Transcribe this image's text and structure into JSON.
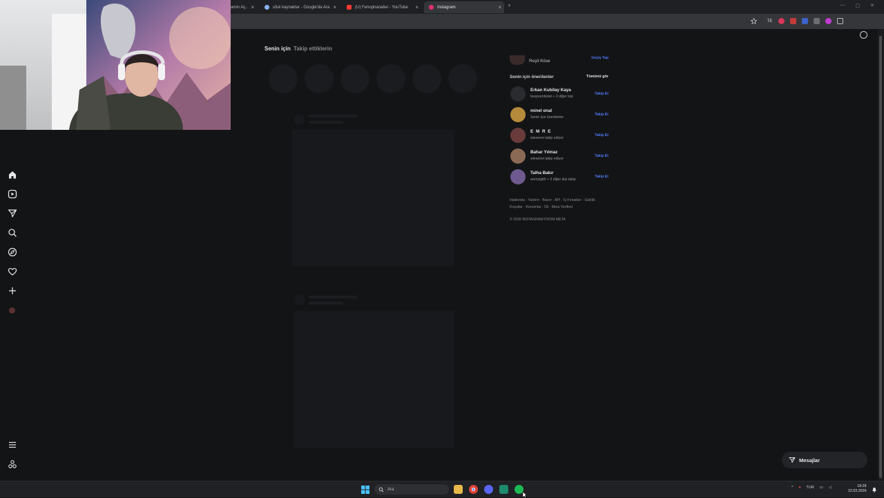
{
  "browser": {
    "tabs": [
      {
        "title": "...amin Aç..",
        "icon_color": "#7d7d7d"
      },
      {
        "title": "ufuk kaynaktar - Google'da Ara",
        "icon_color": "#8ab4f8"
      },
      {
        "title": "(U) Fenophanatiei - YouTube",
        "icon_color": "#ff3b30"
      },
      {
        "title": "Instagram",
        "icon_color": "#e1306c"
      }
    ],
    "new_tab": "+",
    "extensions": [
      "TE",
      "",
      "",
      "",
      "",
      "",
      ""
    ]
  },
  "instagram": {
    "feed_tabs": [
      "Senin için",
      "Takip ettiklerin"
    ],
    "current_user": {
      "name": "Reşit Köse",
      "action": "Geçiş Yap"
    },
    "suggestions_title": "Senin için önerilenler",
    "see_all": "Tümünü gör",
    "suggestions": [
      {
        "name": "Erkan Kubilay Kaya",
        "sub": "besjoumbolat + 3 diğer kişi",
        "action": "Takip Et",
        "color": "#2a2b2e"
      },
      {
        "name": "minel onal",
        "sub": "Senin için önerilenler",
        "action": "Takip Et",
        "color": "#b58a3a"
      },
      {
        "name": "E M R E",
        "sub": "wiesenvi takip ediyor",
        "action": "Takip Et",
        "color": "#6a3b3b"
      },
      {
        "name": "Bahar Yılmaz",
        "sub": "wiesenvi takip ediyor",
        "action": "Takip Et",
        "color": "#8a6a55"
      },
      {
        "name": "Talha Bakır",
        "sub": "arenyigit9 + 3 diğer kişi takip",
        "action": "Takip Et",
        "color": "#6e5a8e"
      }
    ],
    "footer_links": "Hakkında · Yardım · Basın · API · İş Fırsatları · Gizlilik ·",
    "footer_links_2": "Koşullar · Konumlar · Dil · Meta Verified",
    "copyright": "© 2026 INSTAGRAM FROM META",
    "messages_label": "Mesajlar"
  },
  "taskbar": {
    "search_placeholder": "Ara",
    "language": "TUR",
    "time": "18:29",
    "date": "22.03.2026"
  }
}
